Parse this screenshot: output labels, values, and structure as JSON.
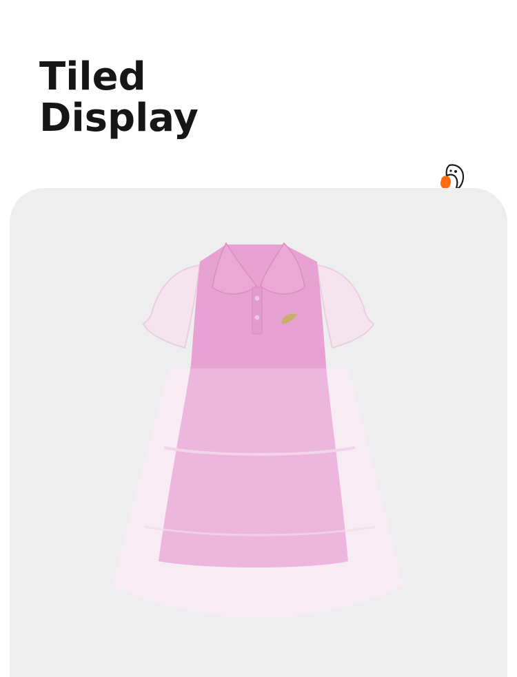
{
  "section": {
    "title_line1": "Tiled",
    "title_line2": "Display"
  },
  "brand": {
    "icon": "bird-logo-icon",
    "accent": "#ff6a13"
  },
  "colors": {
    "background": "#ffffff",
    "card": "#eeeeee",
    "dress_pink": "#e9a3d4",
    "tulle": "#f4dff0",
    "title": "#161616"
  },
  "product": {
    "icon": "pink-polo-tulle-dress-image"
  }
}
